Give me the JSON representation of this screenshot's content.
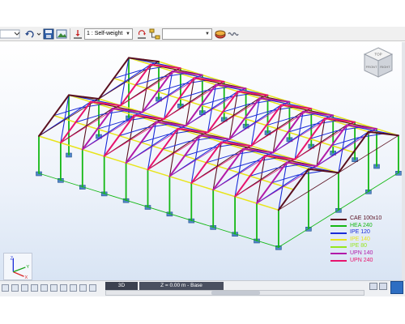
{
  "toolbar": {
    "load_case": "1 : Self-weight",
    "empty_combo": ""
  },
  "view": {
    "mode_tab": "3D",
    "level_tab": "Z = 0.00 m - Base"
  },
  "viewcube": {
    "face_top": "TOP",
    "face_front": "FRONT",
    "face_right": "RIGHT"
  },
  "axes": {
    "x": "X",
    "y": "Y",
    "z": "Z"
  },
  "legend": [
    {
      "label": "CAE 100x10",
      "color": "#5a1020"
    },
    {
      "label": "HEA 240",
      "color": "#14b814"
    },
    {
      "label": "IPE 120",
      "color": "#1a2cd8"
    },
    {
      "label": "IPE 140",
      "color": "#e8e41a"
    },
    {
      "label": "IPE 80",
      "color": "#96e61e"
    },
    {
      "label": "UPN 140",
      "color": "#b21aa8"
    },
    {
      "label": "UPN 240",
      "color": "#e8146e"
    }
  ],
  "colors": {
    "column": "#14b814",
    "purlin": "#e8e41a",
    "bracing": "#1a2cd8",
    "rafter": "#e8146e",
    "rafter_alt": "#b21aa8",
    "tie": "#5a1020",
    "footing": "#4f86c8"
  },
  "icons": [
    "undo-icon",
    "clock-icon",
    "floppy-icon",
    "image-icon",
    "load-icon",
    "moment-icon",
    "tree-icon",
    "color-icon",
    "spring-icon"
  ]
}
